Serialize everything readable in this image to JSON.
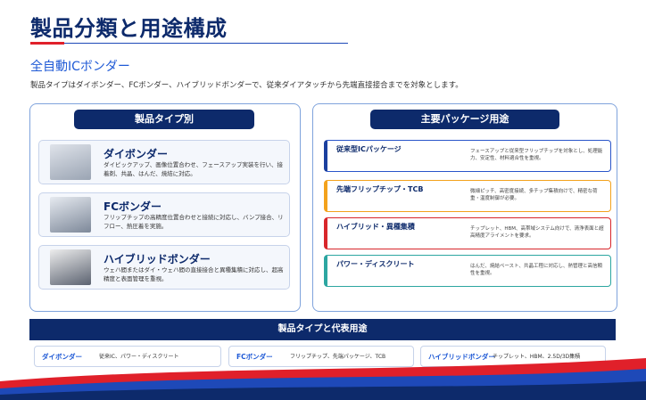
{
  "title": "製品分類と用途構成",
  "subtitle": "全自動ICボンダー",
  "description": "製品タイプはダイボンダー、FCボンダー、ハイブリッドボンダーで、従来ダイアタッチから先端直接接合までを対象とします。",
  "left_panel": {
    "header": "製品タイプ別",
    "products": [
      {
        "name": "ダイボンダー",
        "desc": "ダイピックアップ、画像位置合わせ、フェースアップ実装を行い、接着剤、共晶、はんだ、焼結に対応。",
        "image": "die-bonder-machine"
      },
      {
        "name": "FCボンダー",
        "desc": "フリップチップの高精度位置合わせと接続に対応し、バンプ接合、リフロー、熱圧着を実施。",
        "image": "fc-bonder-machine"
      },
      {
        "name": "ハイブリッドボンダー",
        "desc": "ウェハ間またはダイ・ウェハ間の直接接合と異種集積に対応し、超高精度と表面管理を重視。",
        "image": "hybrid-bonder-machine"
      }
    ]
  },
  "right_panel": {
    "header": "主要パッケージ用途",
    "packages": [
      {
        "name": "従来型ICパッケージ",
        "desc": "フェースアップと従来型フリップチップを対象とし、処理能力、安定性、材料適合性を重視。",
        "color": "#1b3f9e"
      },
      {
        "name": "先端フリップチップ・TCB",
        "desc": "微細ピッチ、高密度接続、多チップ集積向けで、精密な荷重・温度制御が必要。",
        "color": "#f3a21c"
      },
      {
        "name": "ハイブリッド・異種集積",
        "desc": "チップレット、HBM、高帯域システム向けで、清浄表面と超高精度アライメントを要求。",
        "color": "#d8262b"
      },
      {
        "name": "パワー・ディスクリート",
        "desc": "はんだ、焼結ペースト、共晶工程に対応し、熱管理と高信頼性を重視。",
        "color": "#2ca6a1"
      }
    ]
  },
  "bottom": {
    "header": "製品タイプと代表用途",
    "items": [
      {
        "name": "ダイボンダー",
        "use": "従来IC、パワー・ディスクリート"
      },
      {
        "name": "FCボンダー",
        "use": "フリップチップ、先端パッケージ、TCB"
      },
      {
        "name": "ハイブリッドボンダー",
        "use": "チップレット、HBM、2.5D/3D集積"
      }
    ]
  },
  "colors": {
    "navy": "#0d2a6b",
    "accent_blue": "#1f5ad6",
    "accent_red": "#e0202a"
  }
}
